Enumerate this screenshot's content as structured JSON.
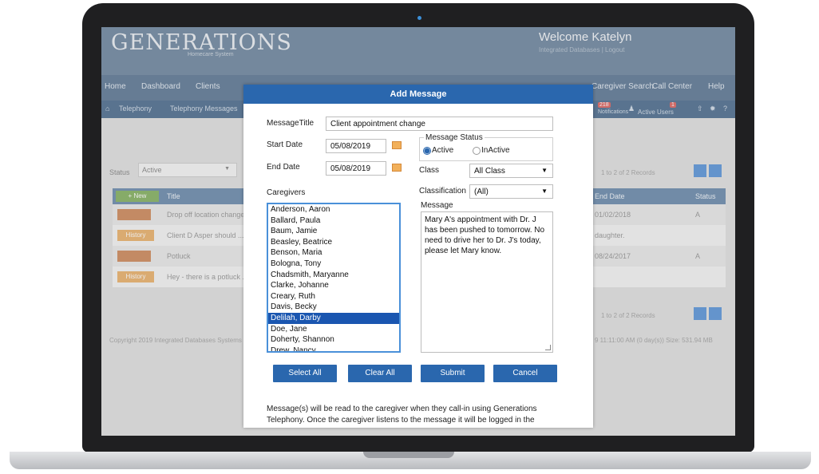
{
  "app": {
    "logo": "GENERATIONS",
    "logo_sub": "Homecare System",
    "welcome": "Welcome Katelyn",
    "welcome_sub": "Integrated Databases | Logout"
  },
  "nav": [
    "Home",
    "Dashboard",
    "Clients",
    "Caregiver Search",
    "Call Center",
    "Help"
  ],
  "subnav": [
    "Telephony",
    "Telephony Messages"
  ],
  "header_counts": {
    "notifications": "218",
    "notifications_label": "Notifications",
    "active_users": "1",
    "active_users_label": "Active Users"
  },
  "page": {
    "status_label": "Status",
    "status_value": "Active",
    "new_button": "+ New",
    "col_title": "Title",
    "col_end_date": "End Date",
    "col_status": "Status",
    "rows": [
      {
        "title": "Drop off location change",
        "end_date": "01/02/2018",
        "status": "A"
      },
      {
        "history": "History",
        "title": "Client D Asper should ...",
        "note": "daughter."
      },
      {
        "title": "Potluck",
        "end_date": "08/24/2017",
        "status": "A"
      },
      {
        "history": "History",
        "title": "Hey - there is a potluck ..."
      }
    ],
    "records": "1 to 2 of 2 Records",
    "copyright": "Copyright 2019 Integrated Databases Systems",
    "footer_right": "9 11:11:00 AM (0 day(s)) Size: 531.94 MB"
  },
  "modal": {
    "title": "Add Message",
    "message_title_label": "MessageTitle",
    "message_title_value": "Client appointment change",
    "start_date_label": "Start Date",
    "start_date_value": "05/08/2019",
    "end_date_label": "End Date",
    "end_date_value": "05/08/2019",
    "message_status_label": "Message Status",
    "status_active": "Active",
    "status_inactive": "InActive",
    "class_label": "Class",
    "class_value": "All Class",
    "classification_label": "Classification",
    "classification_value": "(All)",
    "caregivers_label": "Caregivers",
    "caregivers": [
      "Anderson, Aaron",
      "Ballard, Paula",
      "Baum, Jamie",
      "Beasley, Beatrice",
      "Benson, Maria",
      "Bologna, Tony",
      "Chadsmith, Maryanne",
      "Clarke, Johanne",
      "Creary, Ruth",
      "Davis, Becky",
      "Delilah, Darby",
      "Doe, Jane",
      "Doherty, Shannon",
      "Drew, Nancy"
    ],
    "selected_caregiver": "Delilah, Darby",
    "message_label": "Message",
    "message_value": "Mary A's appointment with Dr. J has been pushed to tomorrow. No need to drive her to Dr. J's today, please let Mary know.",
    "select_all": "Select All",
    "clear_all": "Clear All",
    "submit": "Submit",
    "cancel": "Cancel",
    "note": "Message(s) will be read to the caregiver when they call-in using Generations Telephony. Once the caregiver listens to the message it will be logged in the"
  }
}
